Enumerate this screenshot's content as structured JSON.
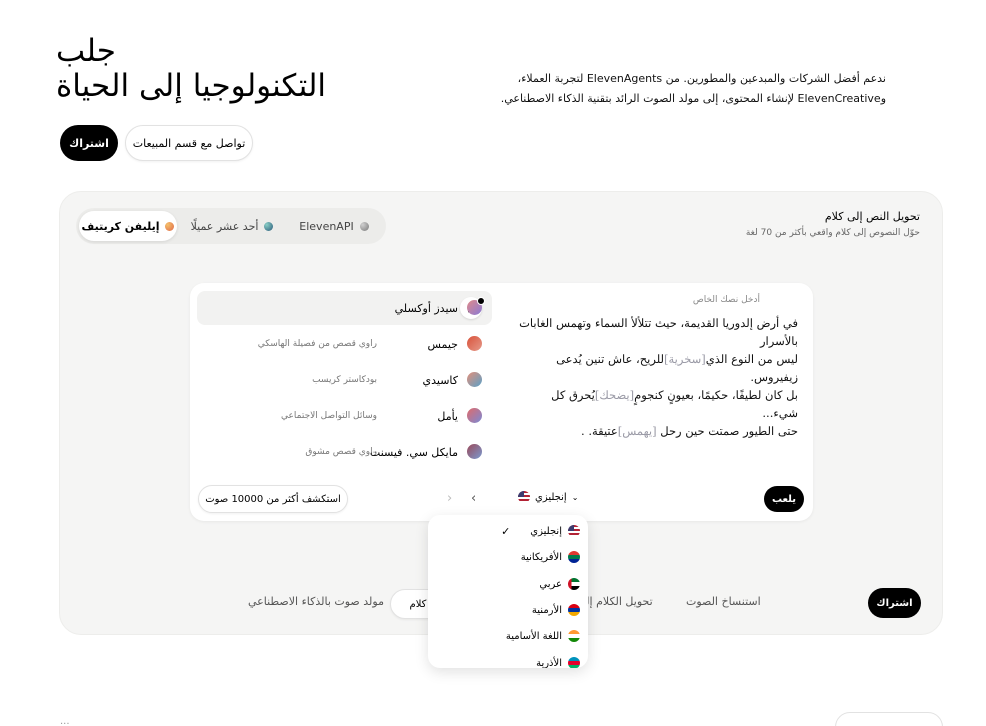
{
  "hero": {
    "title_line1": "جلب",
    "title_line2": "التكنولوجيا إلى الحياة",
    "description_line1": "ندعم أفضل الشركات والمبدعين والمطورين. من ElevenAgents لتجربة العملاء،",
    "description_line2": "وElevenCreative لإنشاء المحتوى، إلى مولد الصوت الرائد بتقنية الذكاء الاصطناعي.",
    "signup_label": "اشتراك",
    "contact_sales_label": "تواصل مع قسم المبيعات"
  },
  "product_tabs": [
    {
      "label": "إيليفن كريتيف",
      "icon": "creative-dot",
      "color": "#e8915a"
    },
    {
      "label": "أحد عشر عميلًا",
      "icon": "agents-dot",
      "color": "#4a8a86"
    },
    {
      "label": "ElevenAPI",
      "icon": "api-dot",
      "color": "#9a9a9a"
    }
  ],
  "feature": {
    "title": "تحويل النص إلى كلام",
    "subtitle": "حوّل النصوص إلى كلام واقعي بأكثر من 70 لغة"
  },
  "voices": [
    {
      "name": "سيدز أوكسلي",
      "desc": "",
      "selected": true,
      "colors": [
        "#e08a8a",
        "#8a7ad6"
      ]
    },
    {
      "name": "جيمس",
      "desc": "راوي قصص من فصيلة الهاسكي",
      "selected": false,
      "colors": [
        "#d9523a",
        "#e59a8a"
      ]
    },
    {
      "name": "كاسيدي",
      "desc": "بودكاستر كريسب",
      "selected": false,
      "colors": [
        "#e3907a",
        "#5aa0c8"
      ]
    },
    {
      "name": "يأمل",
      "desc": "وسائل التواصل الاجتماعي",
      "selected": false,
      "colors": [
        "#e06a6a",
        "#7a8ad6"
      ]
    },
    {
      "name": "مايكل سي. فيسنت",
      "desc": "راوي قصص مشوق",
      "selected": false,
      "colors": [
        "#9a4a5a",
        "#7a9ad0"
      ]
    }
  ],
  "explore_label": "استكشف أكثر من 10000 صوت",
  "editor": {
    "label": "أدخل نصك الخاص",
    "line1": "في أرض إلدوريا القديمة، حيث تتلألأ السماء وتهمس الغابات بالأسرار",
    "line2_a": "ليس من النوع الذي",
    "line2_tag": "[سخرية]",
    "line2_b": "للريح، عاش تنين يُدعى زيفيروس.",
    "line3_a": "بل كان لطيفًا، حكيمًا، بعيونٍ كنجومٍ",
    "line3_tag": "[يضحك]",
    "line3_b": "يُحرق كل شيء...",
    "line4_a": "حتى الطيور صمتت حين رحل",
    "line4_tag": "[يهمس]",
    "line4_b": "عتيقة.",
    "line4_c": ".",
    "play_label": "يلعب",
    "language_selected": "إنجليزي"
  },
  "languages": [
    {
      "label": "إنجليزي",
      "checked": true,
      "colors": [
        "#b22234",
        "#3c3b6e"
      ]
    },
    {
      "label": "الأفريكانية",
      "checked": false,
      "colors": [
        "#007a4d",
        "#de3831"
      ]
    },
    {
      "label": "عربي",
      "checked": false,
      "colors": [
        "#00732f",
        "#ce1126"
      ]
    },
    {
      "label": "الأرمنية",
      "checked": false,
      "colors": [
        "#d90012",
        "#0033a0"
      ]
    },
    {
      "label": "اللغة الأسامية",
      "checked": false,
      "colors": [
        "#ff9933",
        "#138808"
      ]
    },
    {
      "label": "الأذرية",
      "checked": false,
      "colors": [
        "#0092bc",
        "#e4002b"
      ]
    }
  ],
  "bottom_tabs": {
    "signup_label": "اشتراك",
    "voice_cloning": "استنساخ الصوت",
    "speech_to": "تحويل الكلام إلى",
    "text_to_speech": "لى كلام",
    "ai_voice_generator": "مولد صوت بالذكاء الاصطناعي"
  },
  "footer": {
    "partial_left": "...",
    "partial_right": "..."
  }
}
